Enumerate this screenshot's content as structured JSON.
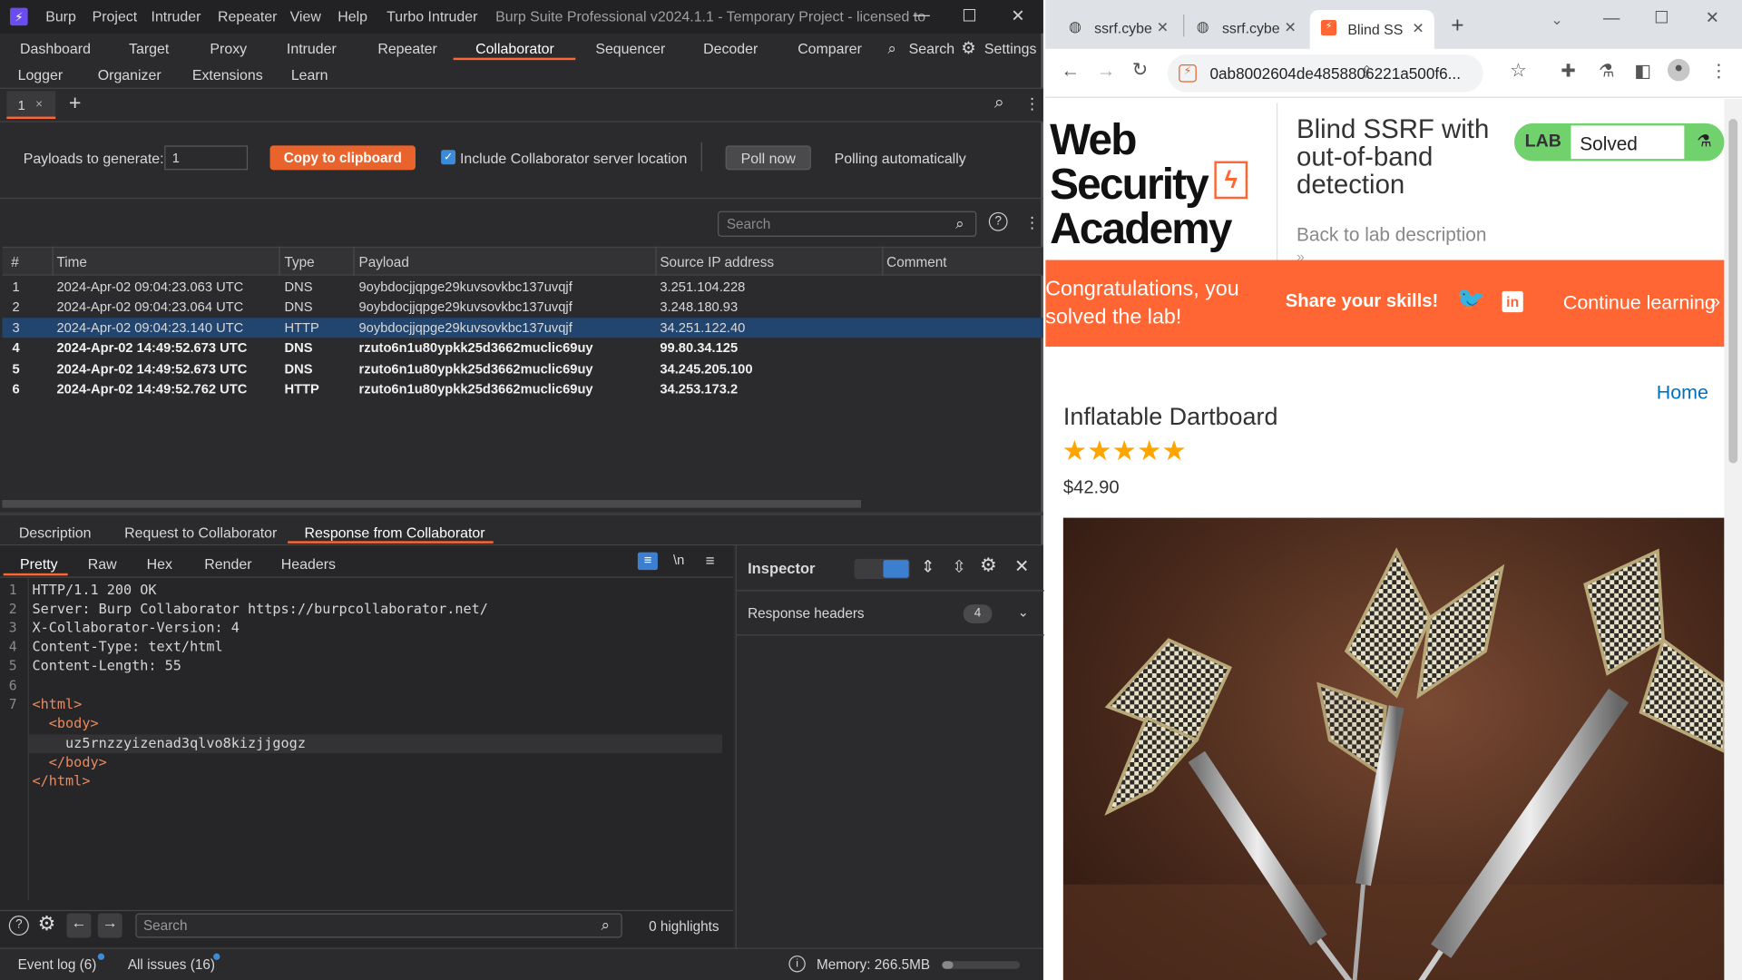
{
  "burp": {
    "menu": [
      "Burp",
      "Project",
      "Intruder",
      "Repeater",
      "View",
      "Help",
      "Turbo Intruder"
    ],
    "title": "Burp Suite Professional v2024.1.1 - Temporary Project - licensed to",
    "tabs_row1": [
      "Dashboard",
      "Target",
      "Proxy",
      "Intruder",
      "Repeater",
      "Collaborator",
      "Sequencer",
      "Decoder",
      "Comparer"
    ],
    "tabs_row2": [
      "Logger",
      "Organizer",
      "Extensions",
      "Learn"
    ],
    "search_label": "Search",
    "settings_label": "Settings",
    "subtab": "1",
    "payloads_label": "Payloads to generate:",
    "payloads_value": "1",
    "copy_button": "Copy to clipboard",
    "include_label": "Include Collaborator server location",
    "poll_button": "Poll now",
    "polling_text": "Polling automatically",
    "table_search_placeholder": "Search",
    "columns": [
      "#",
      "Time",
      "Type",
      "Payload",
      "Source IP address",
      "Comment"
    ],
    "rows": [
      {
        "n": "1",
        "time": "2024-Apr-02 09:04:23.063 UTC",
        "type": "DNS",
        "payload": "9oybdocjjqpge29kuvsovkbc137uvqjf",
        "ip": "3.251.104.228"
      },
      {
        "n": "2",
        "time": "2024-Apr-02 09:04:23.064 UTC",
        "type": "DNS",
        "payload": "9oybdocjjqpge29kuvsovkbc137uvqjf",
        "ip": "3.248.180.93"
      },
      {
        "n": "3",
        "time": "2024-Apr-02 09:04:23.140 UTC",
        "type": "HTTP",
        "payload": "9oybdocjjqpge29kuvsovkbc137uvqjf",
        "ip": "34.251.122.40"
      },
      {
        "n": "4",
        "time": "2024-Apr-02 14:49:52.673 UTC",
        "type": "DNS",
        "payload": "rzuto6n1u80ypkk25d3662muclic69uy",
        "ip": "99.80.34.125"
      },
      {
        "n": "5",
        "time": "2024-Apr-02 14:49:52.673 UTC",
        "type": "DNS",
        "payload": "rzuto6n1u80ypkk25d3662muclic69uy",
        "ip": "34.245.205.100"
      },
      {
        "n": "6",
        "time": "2024-Apr-02 14:49:52.762 UTC",
        "type": "HTTP",
        "payload": "rzuto6n1u80ypkk25d3662muclic69uy",
        "ip": "34.253.173.2"
      }
    ],
    "detail_tabs": [
      "Description",
      "Request to Collaborator",
      "Response from Collaborator"
    ],
    "view_tabs": [
      "Pretty",
      "Raw",
      "Hex",
      "Render",
      "Headers"
    ],
    "newline_label": "\\n",
    "code_lines": [
      "HTTP/1.1 200 OK",
      "Server: Burp Collaborator https://burpcollaborator.net/",
      "X-Collaborator-Version: 4",
      "Content-Type: text/html",
      "Content-Length: 55",
      "",
      "<html>",
      "  <body>",
      "    uz5rnzzyizenad3qlvo8kizjjgogz",
      "  </body>",
      "</html>"
    ],
    "line_numbers": [
      "1",
      "2",
      "3",
      "4",
      "5",
      "6",
      "7"
    ],
    "inspector_title": "Inspector",
    "response_headers_label": "Response headers",
    "response_headers_count": "4",
    "editor_search_placeholder": "Search",
    "highlights": "0 highlights",
    "event_log": "Event log (6)",
    "all_issues": "All issues (16)",
    "memory": "Memory: 266.5MB"
  },
  "browser": {
    "tabs": [
      "ssrf.cybe",
      "ssrf.cybe",
      "Blind SS"
    ],
    "url": "0ab8002604de4858806221a500f6...",
    "logo_line1": "Web Security",
    "logo_line2": "Academy",
    "lab_title": "Blind SSRF with out-of-band detection",
    "lab_badge": "LAB",
    "lab_status": "Solved",
    "back_link": "Back to lab description",
    "back_arrows": "»",
    "congrats": "Congratulations, you solved the lab!",
    "share": "Share your skills!",
    "continue": "Continue learning",
    "continue_arrows": "»",
    "home": "Home",
    "product_name": "Inflatable Dartboard",
    "rating": 5,
    "price": "$42.90",
    "colors": {
      "accent": "#ff6633",
      "green": "#70d16d",
      "link": "#0071bc"
    }
  }
}
